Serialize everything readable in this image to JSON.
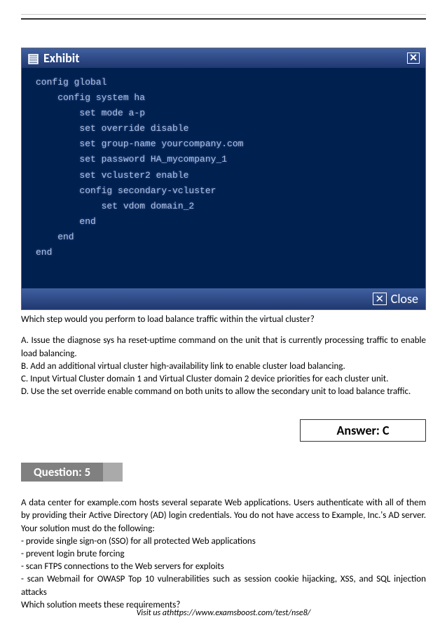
{
  "exhibit": {
    "title": "Exhibit",
    "close_x": "✕",
    "close_label": "Close",
    "code": "config global\n    config system ha\n        set mode a-p\n        set override disable\n        set group-name yourcompany.com\n        set password HA_mycompany_1\n        set vcluster2 enable\n        config secondary-vcluster\n            set vdom domain_2\n        end\n    end\nend"
  },
  "q4": {
    "stem": "Which step would you perform to load balance traffic within the virtual cluster?",
    "optA": "A. Issue the diagnose sys ha reset-uptime command on the unit that is currently processing traffic to enable load balancing.",
    "optB": "B. Add an additional virtual cluster high-availability link to enable cluster load balancing.",
    "optC": "C. Input Virtual Cluster domain 1 and Virtual Cluster domain 2 device priorities for each cluster unit.",
    "optD": "D. Use the set override enable command on both units to allow the secondary unit to load balance traffic.",
    "answer": "Answer: C"
  },
  "q5": {
    "label": "Question: 5",
    "p1": "A data center for example.com hosts several separate Web applications. Users authenticate with all of them by providing their Active Directory (AD) login credentials. You do not have access to Example, Inc.'s AD server. Your solution must do the following:",
    "b1": "- provide single sign-on (SSO) for all protected Web applications",
    "b2": "- prevent login brute forcing",
    "b3": "- scan FTPS connections to the Web servers for exploits",
    "b4": "- scan Webmail for OWASP Top 10 vulnerabilities such as session cookie hijacking, XSS, and SQL injection attacks",
    "p2": "Which solution meets these requirements?"
  },
  "footer": {
    "text": "Visit us athttps://www.examsboost.com/test/nse8/"
  }
}
